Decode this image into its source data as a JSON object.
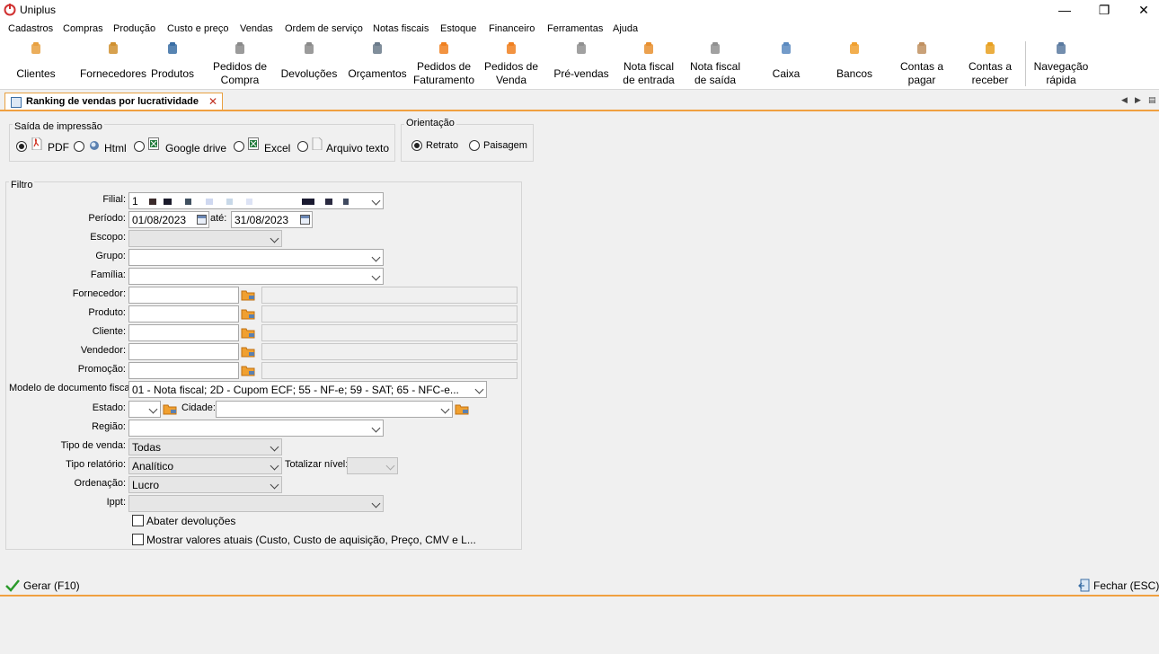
{
  "app": {
    "title": "Uniplus"
  },
  "window": {
    "minimize": "—",
    "restore": "❐",
    "close": "✕"
  },
  "menu": [
    "Cadastros",
    "Compras",
    "Produção",
    "Custo e preço",
    "Vendas",
    "Ordem de serviço",
    "Notas fiscais",
    "Estoque",
    "Financeiro",
    "Ferramentas",
    "Ajuda"
  ],
  "toolbar": [
    {
      "l1": "Clientes",
      "l2": "",
      "icon": "person-icon",
      "color": "#e8a040"
    },
    {
      "l1": "Fornecedores",
      "l2": "",
      "icon": "supplier-icon",
      "color": "#d09030"
    },
    {
      "l1": "Produtos",
      "l2": "",
      "icon": "box-icon",
      "color": "#3a6ea5"
    },
    {
      "l1": "Pedidos de",
      "l2": "Compra",
      "icon": "purchase-order-icon",
      "color": "#8a8a8a"
    },
    {
      "l1": "Devoluções",
      "l2": "",
      "icon": "return-icon",
      "color": "#8a8a8a"
    },
    {
      "l1": "Orçamentos",
      "l2": "",
      "icon": "quote-icon",
      "color": "#6a7a8a"
    },
    {
      "l1": "Pedidos de",
      "l2": "Faturamento",
      "icon": "billing-order-icon",
      "color": "#f08020"
    },
    {
      "l1": "Pedidos de",
      "l2": "Venda",
      "icon": "sales-order-icon",
      "color": "#f08020"
    },
    {
      "l1": "Pré-vendas",
      "l2": "",
      "icon": "cart-icon",
      "color": "#909090"
    },
    {
      "l1": "Nota fiscal",
      "l2": "de entrada",
      "icon": "invoice-in-icon",
      "color": "#e89030"
    },
    {
      "l1": "Nota fiscal",
      "l2": "de saída",
      "icon": "invoice-out-icon",
      "color": "#909090"
    },
    {
      "l1": "Caixa",
      "l2": "",
      "icon": "cash-register-icon",
      "color": "#5a8ac0"
    },
    {
      "l1": "Bancos",
      "l2": "",
      "icon": "piggy-bank-icon",
      "color": "#f0a030"
    },
    {
      "l1": "Contas a",
      "l2": "pagar",
      "icon": "payable-icon",
      "color": "#c09060"
    },
    {
      "l1": "Contas a",
      "l2": "receber",
      "icon": "receivable-icon",
      "color": "#e8a020"
    },
    {
      "l1": "Navegação",
      "l2": "rápida",
      "icon": "binoculars-icon",
      "color": "#5a7aa0"
    }
  ],
  "tab": {
    "title": "Ranking de vendas por lucratividade",
    "close": "✕"
  },
  "tabnav": {
    "prev": "◀",
    "next": "▶",
    "menu": "▤"
  },
  "output": {
    "title": "Saída de impressão",
    "options": [
      "PDF",
      "Html",
      "Google drive",
      "Excel",
      "Arquivo texto"
    ],
    "selected": "PDF"
  },
  "orientation": {
    "title": "Orientação",
    "options": [
      "Retrato",
      "Paisagem"
    ],
    "selected": "Retrato"
  },
  "filter": {
    "title": "Filtro",
    "filial_label": "Filial:",
    "filial_value": "1",
    "periodo_label": "Período:",
    "date_from": "01/08/2023",
    "ate_label": "até:",
    "date_to": "31/08/2023",
    "escopo_label": "Escopo:",
    "grupo_label": "Grupo:",
    "familia_label": "Família:",
    "fornecedor_label": "Fornecedor:",
    "produto_label": "Produto:",
    "cliente_label": "Cliente:",
    "vendedor_label": "Vendedor:",
    "promocao_label": "Promoção:",
    "modelo_label": "Modelo de documento fiscal:",
    "modelo_value": "01 - Nota fiscal; 2D - Cupom ECF; 55 - NF-e; 59 - SAT; 65 - NFC-e...",
    "estado_label": "Estado:",
    "cidade_label": "Cidade:",
    "regiao_label": "Região:",
    "tipo_venda_label": "Tipo de venda:",
    "tipo_venda_value": "Todas",
    "tipo_relatorio_label": "Tipo relatório:",
    "tipo_relatorio_value": "Analítico",
    "totalizar_label": "Totalizar nível:",
    "ordenacao_label": "Ordenação:",
    "ordenacao_value": "Lucro",
    "ippt_label": "Ippt:",
    "abater_label": "Abater devoluções",
    "mostrar_label": "Mostrar valores atuais (Custo, Custo de aquisição, Preço, CMV e L..."
  },
  "footer": {
    "gerar": "Gerar (F10)",
    "fechar": "Fechar (ESC)"
  },
  "colors": {
    "accent": "#f0a040",
    "pdf": "#d03020",
    "excel": "#1f7a3a",
    "lookup": "#f0a030"
  }
}
